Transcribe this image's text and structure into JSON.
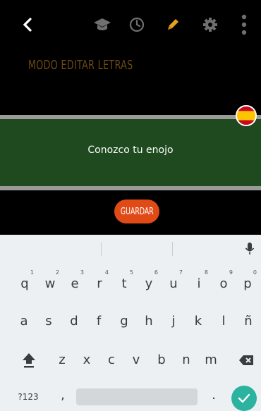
{
  "toolbar": {
    "back_icon": "chevron-left-icon",
    "icons": [
      "graduation-cap-icon",
      "clock-icon",
      "pencil-icon",
      "gear-icon",
      "more-vertical-icon"
    ]
  },
  "mode_title": "MODO EDITAR LETRAS",
  "lyric_line": "Conozco tu enojo",
  "language_flag": "spain-flag-icon",
  "save_label": "GUARDAR",
  "keyboard": {
    "row1": [
      {
        "key": "q",
        "num": "1"
      },
      {
        "key": "w",
        "num": "2"
      },
      {
        "key": "e",
        "num": "3"
      },
      {
        "key": "r",
        "num": "4"
      },
      {
        "key": "t",
        "num": "5"
      },
      {
        "key": "y",
        "num": "6"
      },
      {
        "key": "u",
        "num": "7"
      },
      {
        "key": "i",
        "num": "8"
      },
      {
        "key": "o",
        "num": "9"
      },
      {
        "key": "p",
        "num": "0"
      }
    ],
    "row2": [
      "a",
      "s",
      "d",
      "f",
      "g",
      "h",
      "j",
      "k",
      "l",
      "ñ"
    ],
    "row3": [
      "z",
      "x",
      "c",
      "v",
      "b",
      "n",
      "m"
    ],
    "symbols_label": "?123",
    "comma": ",",
    "period": ".",
    "mic_icon": "microphone-icon",
    "shift_icon": "shift-icon",
    "backspace_icon": "backspace-icon",
    "enter_icon": "check-icon"
  },
  "colors": {
    "panel": "#1f4a1f",
    "accent_button": "#e04a16",
    "enter": "#2bb3a0",
    "pencil": "#e5a21a"
  }
}
